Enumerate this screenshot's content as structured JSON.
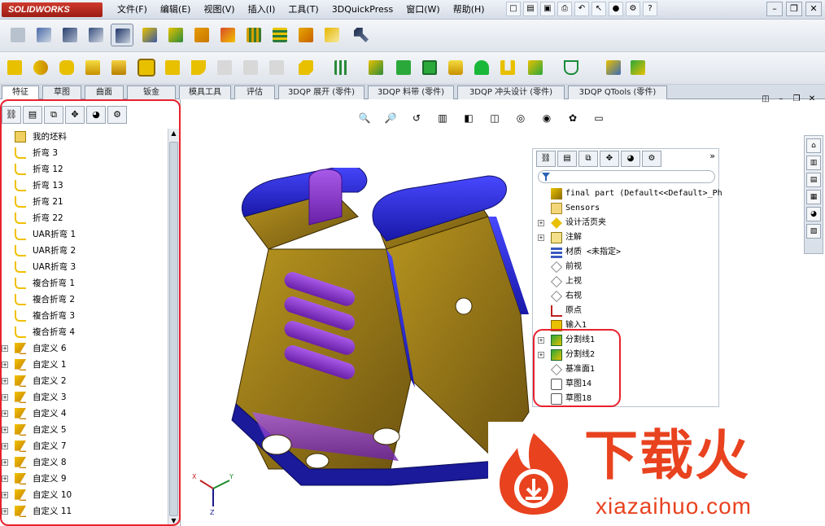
{
  "app": {
    "logo_text": "SOLIDWORKS"
  },
  "menu": [
    "文件(F)",
    "编辑(E)",
    "视图(V)",
    "插入(I)",
    "工具(T)",
    "3DQuickPress",
    "窗口(W)",
    "帮助(H)"
  ],
  "tabs": [
    "特征",
    "草图",
    "曲面",
    "钣金",
    "模具工具",
    "评估",
    "3DQP 展开 (零件)",
    "3DQP 料带 (零件)",
    "3DQP 冲头设计 (零件)",
    "3DQP QTools (零件)"
  ],
  "active_tab": "特征",
  "left_tree": [
    {
      "label": "我的坯料",
      "icon": "material-icon",
      "expand": false
    },
    {
      "label": "折弯 3",
      "icon": "bend-icon",
      "expand": false
    },
    {
      "label": "折弯 12",
      "icon": "bend-icon",
      "expand": false
    },
    {
      "label": "折弯 13",
      "icon": "bend-icon",
      "expand": false
    },
    {
      "label": "折弯 21",
      "icon": "bend-icon",
      "expand": false
    },
    {
      "label": "折弯 22",
      "icon": "bend-icon",
      "expand": false
    },
    {
      "label": "UAR折弯 1",
      "icon": "bend-icon",
      "expand": false
    },
    {
      "label": "UAR折弯 2",
      "icon": "bend-icon",
      "expand": false
    },
    {
      "label": "UAR折弯 3",
      "icon": "bend-icon",
      "expand": false
    },
    {
      "label": "複合折弯 1",
      "icon": "bend-icon",
      "expand": false
    },
    {
      "label": "複合折弯 2",
      "icon": "bend-icon",
      "expand": false
    },
    {
      "label": "複合折弯 3",
      "icon": "bend-icon",
      "expand": false
    },
    {
      "label": "複合折弯 4",
      "icon": "bend-icon",
      "expand": false
    },
    {
      "label": "自定义 6",
      "icon": "custom-feature-icon",
      "expand": true
    },
    {
      "label": "自定义 1",
      "icon": "custom-feature-icon",
      "expand": true
    },
    {
      "label": "自定义 2",
      "icon": "custom-feature-icon",
      "expand": true
    },
    {
      "label": "自定义 3",
      "icon": "custom-feature-icon",
      "expand": true
    },
    {
      "label": "自定义 4",
      "icon": "custom-feature-icon",
      "expand": true
    },
    {
      "label": "自定义 5",
      "icon": "custom-feature-icon",
      "expand": true
    },
    {
      "label": "自定义 7",
      "icon": "custom-feature-icon",
      "expand": true
    },
    {
      "label": "自定义 8",
      "icon": "custom-feature-icon",
      "expand": true
    },
    {
      "label": "自定义 9",
      "icon": "custom-feature-icon",
      "expand": true
    },
    {
      "label": "自定义 10",
      "icon": "custom-feature-icon",
      "expand": true
    },
    {
      "label": "自定义 11",
      "icon": "custom-feature-icon",
      "expand": true
    }
  ],
  "feature_tree": [
    {
      "label": "final part  (Default<<Default>_Ph",
      "icon": "part-icon",
      "expand": false
    },
    {
      "label": "Sensors",
      "icon": "sensor-folder-icon",
      "expand": false
    },
    {
      "label": "设计活页夹",
      "icon": "design-binder-icon",
      "expand": true
    },
    {
      "label": "注解",
      "icon": "annotations-icon",
      "expand": true
    },
    {
      "label": "材质 <未指定>",
      "icon": "material-icon",
      "expand": false
    },
    {
      "label": "前视",
      "icon": "plane-icon",
      "expand": false
    },
    {
      "label": "上视",
      "icon": "plane-icon",
      "expand": false
    },
    {
      "label": "右视",
      "icon": "plane-icon",
      "expand": false
    },
    {
      "label": "原点",
      "icon": "origin-icon",
      "expand": false
    },
    {
      "label": "输入1",
      "icon": "import-icon",
      "expand": false
    },
    {
      "label": "分割线1",
      "icon": "split-line-icon",
      "expand": true
    },
    {
      "label": "分割线2",
      "icon": "split-line-icon",
      "expand": true
    },
    {
      "label": "基准面1",
      "icon": "plane-icon",
      "expand": false
    },
    {
      "label": "草图14",
      "icon": "sketch-icon",
      "expand": false
    },
    {
      "label": "草图18",
      "icon": "sketch-icon",
      "expand": false
    }
  ],
  "watermark": {
    "main": "下载火",
    "sub": "xiazaihuo.com"
  },
  "triad": {
    "x": "X",
    "y": "Y",
    "z": "Z"
  },
  "colors": {
    "part_gold": "#9a7a1e",
    "part_blue": "#2a2ad8",
    "part_purple": "#8a3cc8",
    "highlight_red": "#e8212d",
    "watermark": "#e8421f"
  }
}
